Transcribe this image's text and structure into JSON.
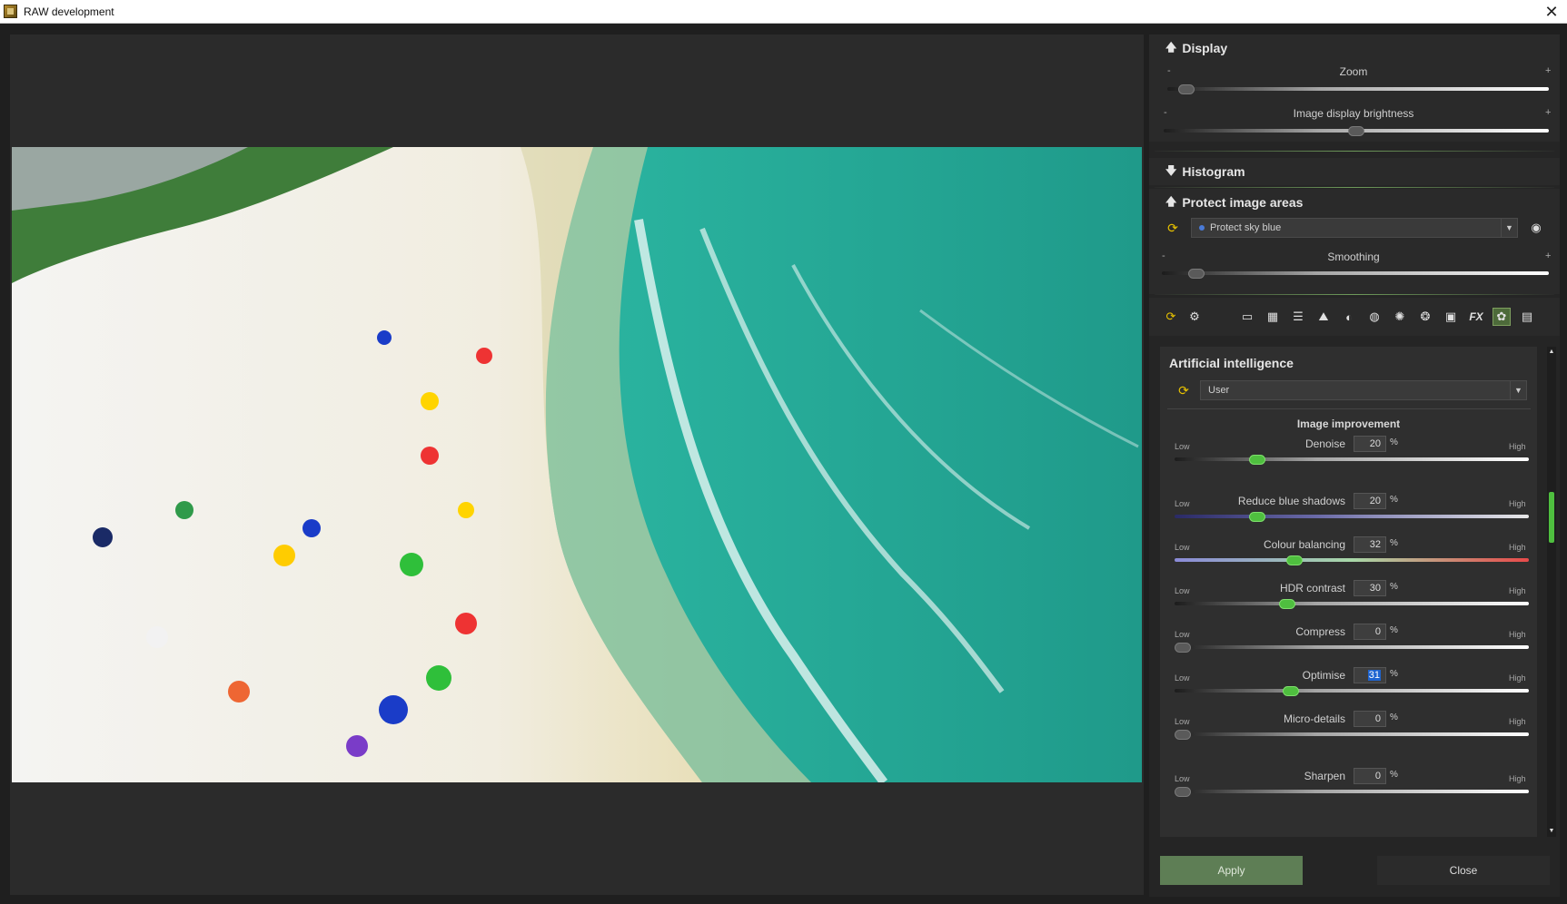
{
  "window": {
    "title": "RAW development",
    "close_glyph": "✕"
  },
  "display": {
    "header": "Display",
    "zoom": {
      "label": "Zoom",
      "minus": "-",
      "plus": "+",
      "value_fraction": 0.03
    },
    "brightness": {
      "label": "Image display brightness",
      "minus": "-",
      "plus": "+",
      "value_fraction": 0.5
    }
  },
  "histogram": {
    "header": "Histogram"
  },
  "protect": {
    "header": "Protect image areas",
    "selected_option": "Protect sky blue",
    "smoothing": {
      "label": "Smoothing",
      "minus": "-",
      "plus": "+",
      "value_fraction": 0.07
    }
  },
  "toolbar": {
    "icons": [
      "reset-icon",
      "settings-icon",
      "white-balance-icon",
      "tone-icon",
      "levels-icon",
      "landscape-icon",
      "contrast-icon",
      "vignette-icon",
      "color-wheel-icon",
      "color-mix-icon",
      "camera-icon",
      "fx-icon",
      "ai-icon",
      "batch-icon"
    ]
  },
  "ai": {
    "title": "Artificial intelligence",
    "preset": "User",
    "subsection": "Image improvement",
    "low": "Low",
    "high": "High",
    "pct": "%",
    "sliders": [
      {
        "label": "Denoise",
        "value": "20",
        "fraction": 0.22,
        "active": true
      },
      {
        "label": "Reduce blue shadows",
        "value": "20",
        "fraction": 0.22,
        "active": true
      },
      {
        "label": "Colour balancing",
        "value": "32",
        "fraction": 0.33,
        "active": true
      },
      {
        "label": "HDR contrast",
        "value": "30",
        "fraction": 0.31,
        "active": true
      },
      {
        "label": "Compress",
        "value": "0",
        "fraction": 0.0,
        "active": false
      },
      {
        "label": "Optimise",
        "value": "31",
        "fraction": 0.32,
        "active": true,
        "selected": true
      },
      {
        "label": "Micro-details",
        "value": "0",
        "fraction": 0.0,
        "active": false
      },
      {
        "label": "Sharpen",
        "value": "0",
        "fraction": 0.0,
        "active": false
      }
    ]
  },
  "buttons": {
    "apply": "Apply",
    "close": "Close"
  }
}
